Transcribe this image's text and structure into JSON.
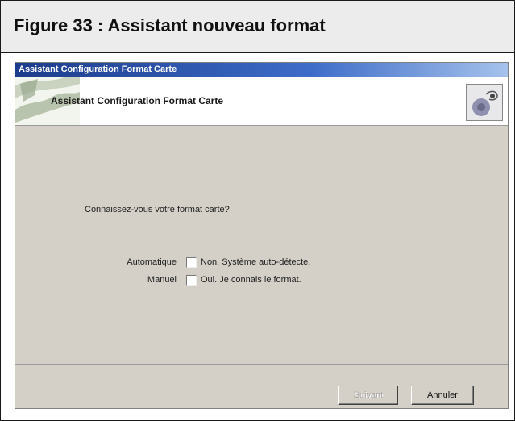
{
  "figure": {
    "title": "Figure 33 : Assistant nouveau format"
  },
  "dialog": {
    "window_title": "Assistant Configuration Format Carte",
    "banner_title": "Assistant Configuration Format Carte",
    "banner_logo_icon": "card-reader-logo-icon",
    "question": "Connaissez-vous votre format carte?",
    "options": [
      {
        "label": "Automatique",
        "text": "Non. Système auto-détecte.",
        "checked": false
      },
      {
        "label": "Manuel",
        "text": "Oui. Je connais le format.",
        "checked": false
      }
    ],
    "buttons": {
      "next": "Suivant",
      "cancel": "Annuler"
    }
  }
}
